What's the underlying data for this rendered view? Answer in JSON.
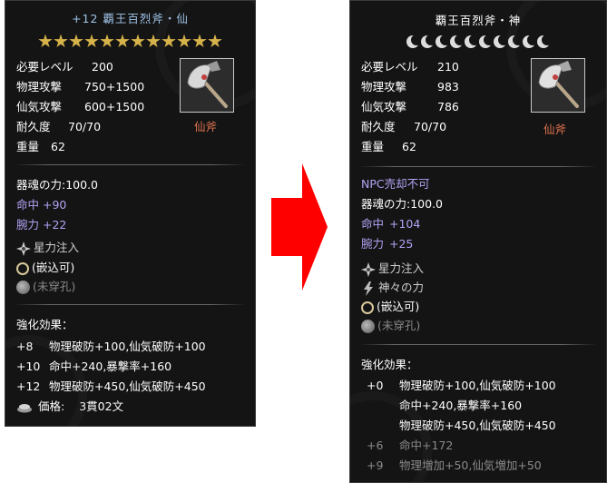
{
  "left": {
    "title": "+12 覇王百烈斧・仙",
    "star_count": 12,
    "stats": [
      {
        "label": "必要レベル",
        "value": "200"
      },
      {
        "label": "物理攻撃",
        "value": "750+1500"
      },
      {
        "label": "仙気攻撃",
        "value": "600+1500"
      },
      {
        "label": "耐久度",
        "value": "70/70"
      },
      {
        "label": "重量",
        "value": "62"
      }
    ],
    "item_type": "仙斧",
    "soul_power": "器魂の力:100.0",
    "hit_label": "命中",
    "hit_value": "+90",
    "arm_label": "腕力",
    "arm_value": "+22",
    "star_infusion": "星力注入",
    "socket_ok": "(嵌込可)",
    "socket_empty": "(未穿孔)",
    "enhance_header": "強化効果：",
    "enhance_rows": [
      {
        "level": "+8",
        "text": "物理破防+100,仙気破防+100"
      },
      {
        "level": "+10",
        "text": "命中+240,暴撃率+160"
      },
      {
        "level": "+12",
        "text": "物理破防+450,仙気破防+450"
      }
    ],
    "price_label": "価格:",
    "price_value": "3貫02文"
  },
  "right": {
    "title": "覇王百烈斧・神",
    "moon_count": 10,
    "stats": [
      {
        "label": "必要レベル",
        "value": "210"
      },
      {
        "label": "物理攻撃",
        "value": "983"
      },
      {
        "label": "仙気攻撃",
        "value": "786"
      },
      {
        "label": "耐久度",
        "value": "70/70"
      },
      {
        "label": "重量",
        "value": "62"
      }
    ],
    "item_type": "仙斧",
    "npc_note": "NPC売却不可",
    "soul_power": "器魂の力:100.0",
    "hit_label": "命中",
    "hit_value": "+104",
    "arm_label": "腕力",
    "arm_value": "+25",
    "star_infusion": "星力注入",
    "divine_power": "神々の力",
    "socket_ok": "(嵌込可)",
    "socket_empty": "(未穿孔)",
    "enhance_header": "強化効果：",
    "enhance_rows": [
      {
        "level": "+0",
        "text": "物理破防+100,仙気破防+100",
        "dim": false
      },
      {
        "level": "",
        "text": "命中+240,暴撃率+160",
        "dim": false
      },
      {
        "level": "",
        "text": "物理破防+450,仙気破防+450",
        "dim": false
      },
      {
        "level": "+6",
        "text": "命中+172",
        "dim": true
      },
      {
        "level": "+9",
        "text": "物理増加+50,仙気増加+50",
        "dim": true
      }
    ]
  },
  "colors": {
    "panel_bg": "#141414",
    "title_left": "#9fc3e8",
    "title_right": "#ffffff",
    "stat_blue": "#b4a3f5",
    "item_type": "#e0734f",
    "arrow": "#ff0000"
  }
}
